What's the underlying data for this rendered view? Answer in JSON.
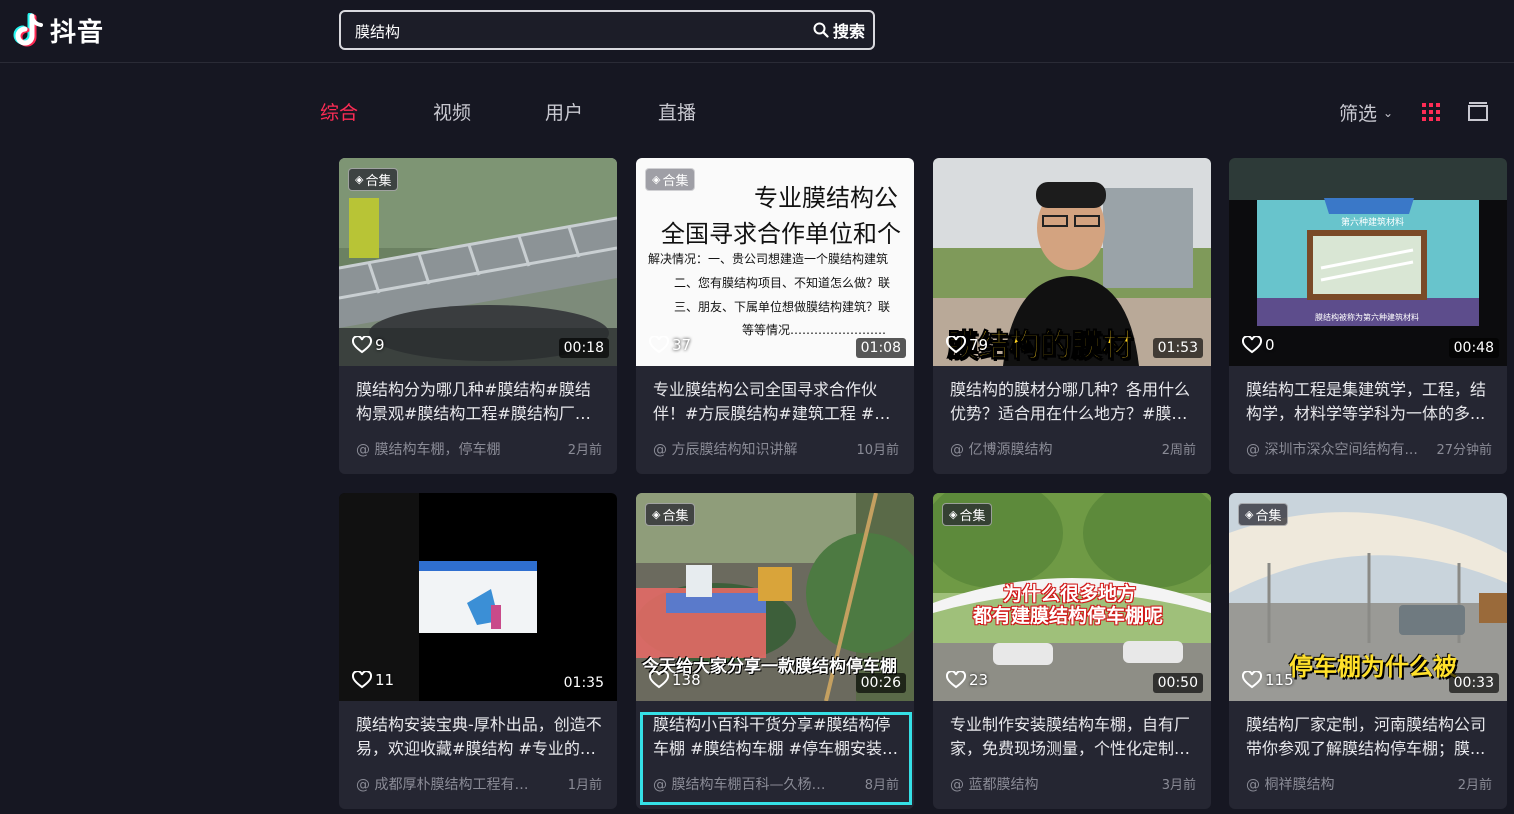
{
  "app": {
    "name": "抖音"
  },
  "search": {
    "value": "膜结构",
    "button_label": "搜索"
  },
  "tabs": [
    {
      "label": "综合",
      "active": true
    },
    {
      "label": "视频",
      "active": false
    },
    {
      "label": "用户",
      "active": false
    },
    {
      "label": "直播",
      "active": false
    }
  ],
  "filter": {
    "label": "筛选"
  },
  "accent_color": "#fe2c55",
  "focus_color": "#35e0e6",
  "videos": [
    {
      "badge": "合集",
      "likes": "9",
      "duration": "00:18",
      "title": "膜结构分为哪几种#膜结构#膜结构景观#膜结构工程#膜结构厂家#...",
      "author": "@ 膜结构车棚，停车棚",
      "time": "2月前"
    },
    {
      "badge": "合集",
      "likes": "37",
      "duration": "01:08",
      "title": "专业膜结构公司全国寻求合作伙伴！#方辰膜结构#建筑工程 #园...",
      "author": "@ 方辰膜结构知识讲解",
      "time": "10月前",
      "thumb_text": {
        "line1": "专业膜结构公",
        "line2": "全国寻求合作单位和个",
        "line3": "解决情况：一、贵公司想建造一个膜结构建筑",
        "line4": "二、您有膜结构项目、不知道怎么做？联",
        "line5": "三、朋友、下属单位想做膜结构建筑？联",
        "line6": "等等情况……………………"
      }
    },
    {
      "badge": "",
      "likes": "79",
      "duration": "01:53",
      "title": "膜结构的膜材分哪几种？各用什么优势？适合用在什么地方？#膜结...",
      "author": "@ 亿博源膜结构",
      "time": "2周前",
      "caption": "膜结构的膜材"
    },
    {
      "badge": "",
      "likes": "0",
      "duration": "00:48",
      "title": "膜结构工程是集建筑学，工程，结构学，材料学等学科为一体的多...",
      "author": "@ 深圳市深众空间结构有...",
      "time": "27分钟前",
      "thumb_text": {
        "banner": "第六种建筑材料",
        "footer": "膜结构被称为第六种建筑材料"
      }
    },
    {
      "badge": "",
      "likes": "11",
      "duration": "01:35",
      "title": "膜结构安装宝典-厚朴出品，创造不易，欢迎收藏#膜结构 #专业的事...",
      "author": "@ 成都厚朴膜结构工程有限...",
      "time": "1月前"
    },
    {
      "badge": "合集",
      "likes": "138",
      "duration": "00:26",
      "title": "膜结构小百科干货分享#膜结构停车棚 #膜结构车棚 #停车棚安装 #...",
      "author": "@ 膜结构车棚百科—久杨膜...",
      "time": "8月前",
      "caption": "今天给大家分享一款膜结构停车棚",
      "focused": true
    },
    {
      "badge": "合集",
      "likes": "23",
      "duration": "00:50",
      "title": "专业制作安装膜结构车棚，自有厂家，免费现场测量，个性化定制#...",
      "author": "@ 蓝都膜结构",
      "time": "3月前",
      "caption1": "为什么很多地方",
      "caption2": "都有建膜结构停车棚呢"
    },
    {
      "badge": "合集",
      "likes": "115",
      "duration": "00:33",
      "title": "膜结构厂家定制，河南膜结构公司带你参观了解膜结构停车棚；膜...",
      "author": "@ 桐祥膜结构",
      "time": "2月前",
      "caption": "停车棚为什么被"
    }
  ]
}
